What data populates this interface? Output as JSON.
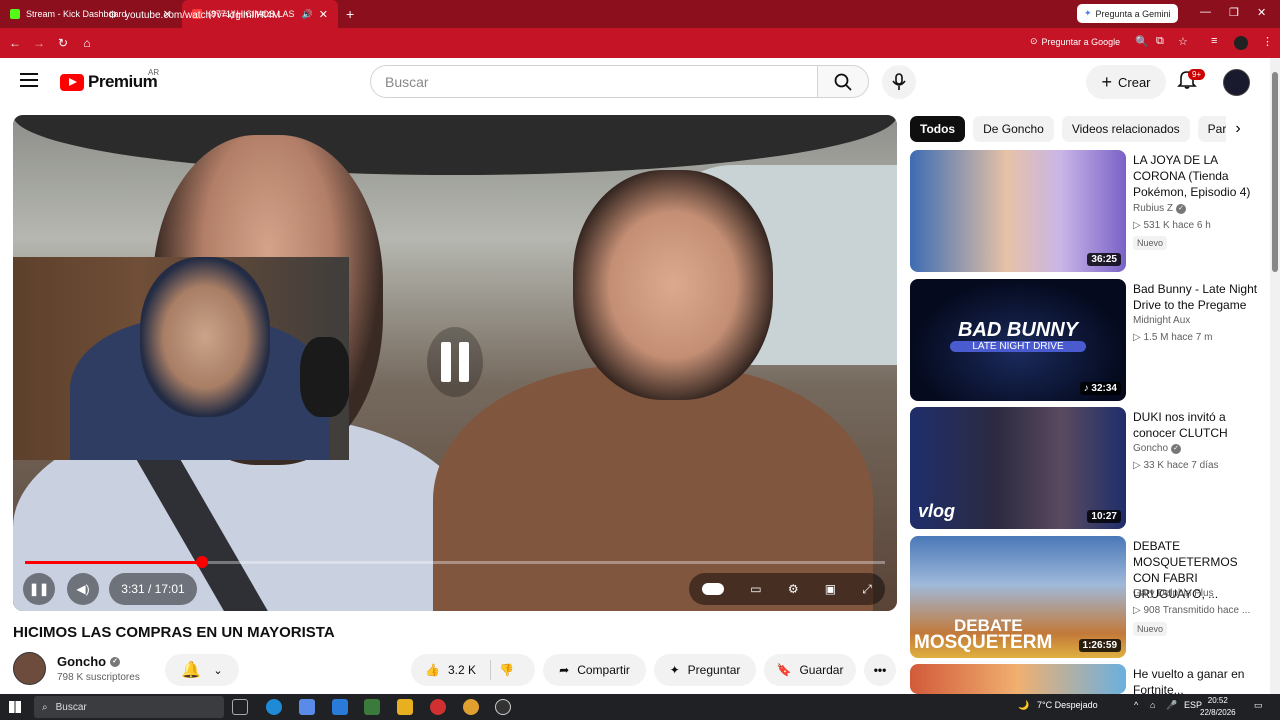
{
  "browser": {
    "tabs": [
      {
        "label": "Stream - Kick Dashboard",
        "active": false
      },
      {
        "label": "(8771) HICIMOS LAS COMP",
        "active": true
      }
    ],
    "gemini_label": "Pregunta a Gemini",
    "url": "youtube.com/watch?v=kfgimIiHt4M",
    "ask_google": "Preguntar a Google"
  },
  "youtube": {
    "logo_text": "Premium",
    "region": "AR",
    "search_placeholder": "Buscar",
    "create_label": "Crear",
    "notification_count": "9+"
  },
  "player": {
    "time": "3:31 / 17:01",
    "progress": 0.206
  },
  "video": {
    "title": "HICIMOS LAS COMPRAS EN UN MAYORISTA",
    "channel": "Goncho",
    "subscribers": "798 K suscriptores",
    "likes": "3.2 K",
    "share_label": "Compartir",
    "ask_label": "Preguntar",
    "save_label": "Guardar"
  },
  "chips": [
    "Todos",
    "De Goncho",
    "Videos relacionados",
    "Par"
  ],
  "recommendations": [
    {
      "title": "LA JOYA DE LA CORONA (Tienda Pokémon, Episodio 4)",
      "channel": "Rubius Z",
      "verified": true,
      "views": "531 K",
      "age": "hace 6 h",
      "badge": "Nuevo",
      "duration": "36:25"
    },
    {
      "title": "Bad Bunny - Late Night Drive to the Pregame",
      "channel": "Midnight Aux",
      "verified": false,
      "views": "1.5 M",
      "age": "hace 7 m",
      "badge": "",
      "duration": "32:34",
      "thumb_text": "BAD BUNNY",
      "thumb_sub": "LATE NIGHT DRIVE"
    },
    {
      "title": "DUKI nos invitó a conocer CLUTCH",
      "channel": "Goncho",
      "verified": true,
      "views": "33 K",
      "age": "hace 7 días",
      "badge": "",
      "duration": "10:27",
      "thumb_text": "vlog"
    },
    {
      "title": "DEBATE MOSQUETERMOS CON FABRI URUGUAYO, ...",
      "channel": "Gary Delphin Plus",
      "verified": false,
      "views": "908",
      "age": "Transmitido hace ...",
      "badge": "Nuevo",
      "duration": "1:26:59",
      "thumb_text": "DEBATE",
      "thumb_sub": "MOSQUETERM"
    },
    {
      "title": "He vuelto a ganar en Fortnite..."
    }
  ],
  "taskbar": {
    "search_label": "Buscar",
    "weather": "7°C Despejado",
    "lang": "ESP",
    "time": "20:52",
    "date": "22/8/2026"
  }
}
